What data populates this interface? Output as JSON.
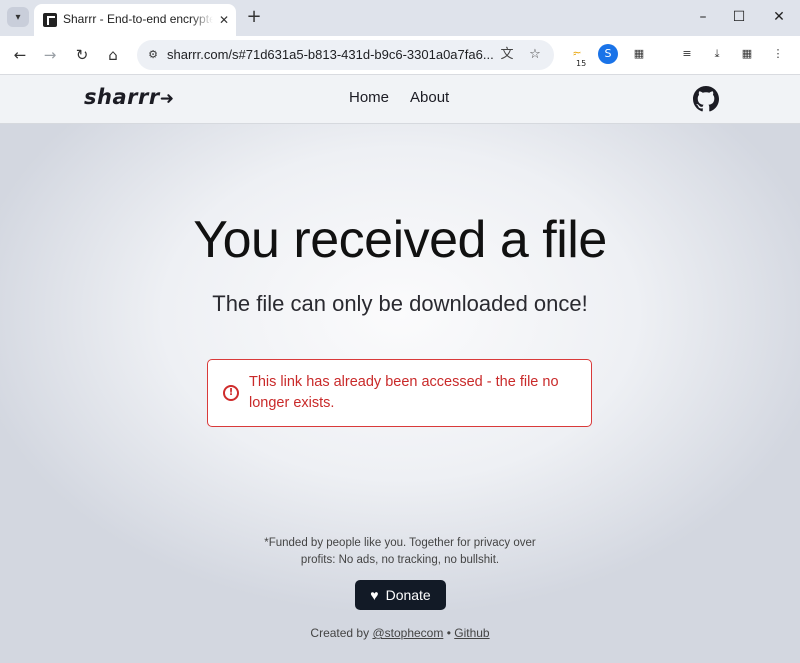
{
  "browser": {
    "tab_title": "Sharrr - End-to-end encrypted",
    "url": "sharrr.com/s#71d631a5-b813-431d-b9c6-3301a0a7fa6...",
    "extension_badge": "15",
    "icons": {
      "tab_search": "chevron-down-icon",
      "tab_close": "close-icon",
      "new_tab": "plus-icon",
      "minimize": "minimize-icon",
      "maximize": "maximize-icon",
      "close_window": "close-icon",
      "back": "back-arrow-icon",
      "forward": "forward-arrow-icon",
      "reload": "reload-icon",
      "home": "home-icon",
      "site_info": "tune-icon",
      "translate": "translate-icon",
      "bookmark": "star-icon",
      "extensions": "puzzle-icon",
      "reading_list": "reading-list-icon",
      "downloads": "download-icon"
    }
  },
  "navbar": {
    "logo": "sharrr",
    "links": [
      "Home",
      "About"
    ],
    "github_icon": "github-icon"
  },
  "hero": {
    "title": "You received a file",
    "subtitle": "The file can only be downloaded once!"
  },
  "alert": {
    "icon": "alert-circle-icon",
    "message": "This link has already been accessed - the file no longer exists.",
    "color": "#c92a2a"
  },
  "footer": {
    "note_line1": "*Funded by people like you. Together for privacy over",
    "note_line2": "profits: No ads, no tracking, no bullshit.",
    "donate_label": "Donate",
    "donate_icon": "heart-icon",
    "credits_prefix": "Created by",
    "credits_author": "@stophecom",
    "credits_separator": "•",
    "credits_github": "Github"
  },
  "colors": {
    "accent_dark": "#121a26",
    "error": "#d93a3a",
    "tab_strip": "#dfe3eb"
  }
}
